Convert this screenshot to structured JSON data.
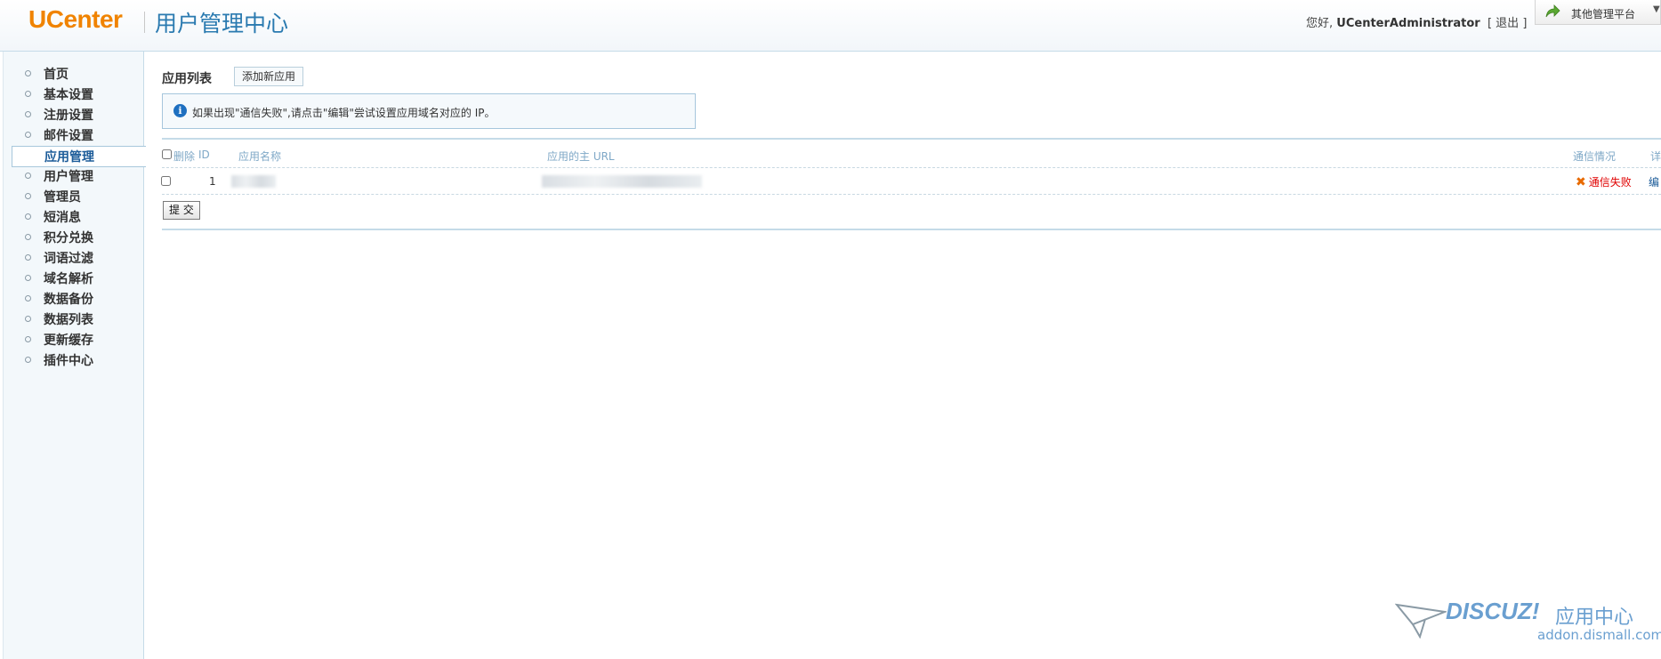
{
  "header": {
    "logo": "UCenter",
    "title": "用户管理中心",
    "greeting": "您好,",
    "username": "UCenterAdministrator",
    "bracket_open": "[",
    "logout": "退出",
    "bracket_close": "]",
    "platform_label": "其他管理平台"
  },
  "sidebar": {
    "items": [
      {
        "label": "首页"
      },
      {
        "label": "基本设置"
      },
      {
        "label": "注册设置"
      },
      {
        "label": "邮件设置"
      },
      {
        "label": "应用管理",
        "active": true
      },
      {
        "label": "用户管理"
      },
      {
        "label": "管理员"
      },
      {
        "label": "短消息"
      },
      {
        "label": "积分兑换"
      },
      {
        "label": "词语过滤"
      },
      {
        "label": "域名解析"
      },
      {
        "label": "数据备份"
      },
      {
        "label": "数据列表"
      },
      {
        "label": "更新缓存"
      },
      {
        "label": "插件中心"
      }
    ]
  },
  "main": {
    "section_title": "应用列表",
    "add_button": "添加新应用",
    "notice": "如果出现\"通信失败\",请点击\"编辑\"尝试设置应用域名对应的 IP。",
    "table": {
      "headers": {
        "delete": "删除",
        "id": "ID",
        "name": "应用名称",
        "url": "应用的主 URL",
        "status": "通信情况",
        "detail": "详"
      },
      "rows": [
        {
          "id": "1",
          "status": "通信失败",
          "action": "编"
        }
      ]
    },
    "submit_button": "提 交"
  },
  "watermark": {
    "brand": "DISCUZ!",
    "brand_cn": "应用中心",
    "url": "addon.dismall.com"
  },
  "colors": {
    "logo": "#f08300",
    "title": "#2a7ab0",
    "fail": "#e00000",
    "accent_border": "#c5dbe8"
  }
}
